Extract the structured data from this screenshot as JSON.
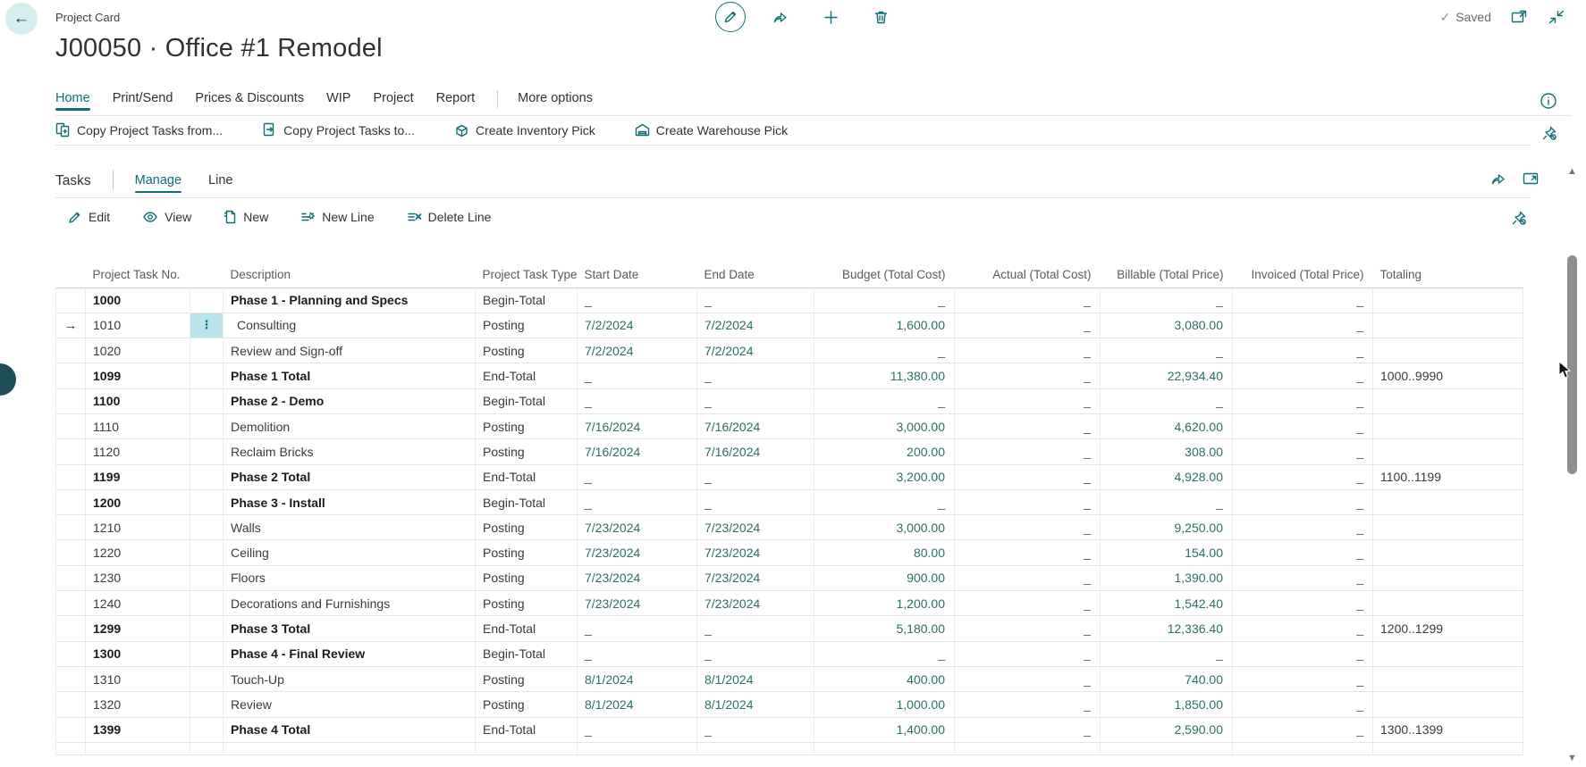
{
  "colors": {
    "accent": "#0e6f74",
    "value_teal": "#2a6f68",
    "selected_cell": "#b9e4ec"
  },
  "header": {
    "app_caption": "Project Card",
    "title": "J00050 · Office #1 Remodel",
    "saved_label": "Saved",
    "saved_check": "✓",
    "back_glyph": "←"
  },
  "tabs": {
    "items": [
      {
        "label": "Home",
        "active": true
      },
      {
        "label": "Print/Send",
        "active": false
      },
      {
        "label": "Prices & Discounts",
        "active": false
      },
      {
        "label": "WIP",
        "active": false
      },
      {
        "label": "Project",
        "active": false
      },
      {
        "label": "Report",
        "active": false
      }
    ],
    "more_label": "More options"
  },
  "actions": [
    {
      "label": "Copy Project Tasks from...",
      "icon": "copy-from-icon"
    },
    {
      "label": "Copy Project Tasks to...",
      "icon": "copy-to-icon"
    },
    {
      "label": "Create Inventory Pick",
      "icon": "inventory-pick-icon"
    },
    {
      "label": "Create Warehouse Pick",
      "icon": "warehouse-pick-icon"
    }
  ],
  "section": {
    "title": "Tasks",
    "menus": [
      {
        "label": "Manage",
        "active": true
      },
      {
        "label": "Line",
        "active": false
      }
    ]
  },
  "grid_actions": [
    {
      "label": "Edit",
      "icon": "edit-icon"
    },
    {
      "label": "View",
      "icon": "view-icon"
    },
    {
      "label": "New",
      "icon": "new-icon"
    },
    {
      "label": "New Line",
      "icon": "new-line-icon"
    },
    {
      "label": "Delete Line",
      "icon": "delete-line-icon"
    }
  ],
  "table": {
    "columns": [
      "Project Task No.",
      "Description",
      "Project Task Type",
      "Start Date",
      "End Date",
      "Budget (Total Cost)",
      "Actual (Total Cost)",
      "Billable (Total Price)",
      "Invoiced (Total Price)",
      "Totaling"
    ],
    "selection_glyphs": {
      "row_indicator": "→",
      "options_dots": "⋮"
    },
    "rows": [
      {
        "no": "1000",
        "desc": "Phase 1 - Planning and Specs",
        "type": "Begin-Total",
        "start": "_",
        "end": "_",
        "budget": "_",
        "actual": "_",
        "billable": "_",
        "invoiced": "_",
        "totaling": "",
        "bold": true,
        "selected": false,
        "indent": false
      },
      {
        "no": "1010",
        "desc": "Consulting",
        "type": "Posting",
        "start": "7/2/2024",
        "end": "7/2/2024",
        "budget": "1,600.00",
        "actual": "_",
        "billable": "3,080.00",
        "invoiced": "_",
        "totaling": "",
        "bold": false,
        "selected": true,
        "indent": true
      },
      {
        "no": "1020",
        "desc": "Review and Sign-off",
        "type": "Posting",
        "start": "7/2/2024",
        "end": "7/2/2024",
        "budget": "_",
        "actual": "_",
        "billable": "_",
        "invoiced": "_",
        "totaling": "",
        "bold": false,
        "selected": false,
        "indent": false
      },
      {
        "no": "1099",
        "desc": "Phase 1 Total",
        "type": "End-Total",
        "start": "_",
        "end": "_",
        "budget": "11,380.00",
        "actual": "_",
        "billable": "22,934.40",
        "invoiced": "_",
        "totaling": "1000..9990",
        "bold": true,
        "selected": false,
        "indent": false
      },
      {
        "no": "1100",
        "desc": "Phase 2 - Demo",
        "type": "Begin-Total",
        "start": "_",
        "end": "_",
        "budget": "_",
        "actual": "_",
        "billable": "_",
        "invoiced": "_",
        "totaling": "",
        "bold": true,
        "selected": false,
        "indent": false
      },
      {
        "no": "1110",
        "desc": "Demolition",
        "type": "Posting",
        "start": "7/16/2024",
        "end": "7/16/2024",
        "budget": "3,000.00",
        "actual": "_",
        "billable": "4,620.00",
        "invoiced": "_",
        "totaling": "",
        "bold": false,
        "selected": false,
        "indent": false
      },
      {
        "no": "1120",
        "desc": "Reclaim Bricks",
        "type": "Posting",
        "start": "7/16/2024",
        "end": "7/16/2024",
        "budget": "200.00",
        "actual": "_",
        "billable": "308.00",
        "invoiced": "_",
        "totaling": "",
        "bold": false,
        "selected": false,
        "indent": false
      },
      {
        "no": "1199",
        "desc": "Phase 2 Total",
        "type": "End-Total",
        "start": "_",
        "end": "_",
        "budget": "3,200.00",
        "actual": "_",
        "billable": "4,928.00",
        "invoiced": "_",
        "totaling": "1100..1199",
        "bold": true,
        "selected": false,
        "indent": false
      },
      {
        "no": "1200",
        "desc": "Phase 3 - Install",
        "type": "Begin-Total",
        "start": "_",
        "end": "_",
        "budget": "_",
        "actual": "_",
        "billable": "_",
        "invoiced": "_",
        "totaling": "",
        "bold": true,
        "selected": false,
        "indent": false
      },
      {
        "no": "1210",
        "desc": "Walls",
        "type": "Posting",
        "start": "7/23/2024",
        "end": "7/23/2024",
        "budget": "3,000.00",
        "actual": "_",
        "billable": "9,250.00",
        "invoiced": "_",
        "totaling": "",
        "bold": false,
        "selected": false,
        "indent": false
      },
      {
        "no": "1220",
        "desc": "Ceiling",
        "type": "Posting",
        "start": "7/23/2024",
        "end": "7/23/2024",
        "budget": "80.00",
        "actual": "_",
        "billable": "154.00",
        "invoiced": "_",
        "totaling": "",
        "bold": false,
        "selected": false,
        "indent": false
      },
      {
        "no": "1230",
        "desc": "Floors",
        "type": "Posting",
        "start": "7/23/2024",
        "end": "7/23/2024",
        "budget": "900.00",
        "actual": "_",
        "billable": "1,390.00",
        "invoiced": "_",
        "totaling": "",
        "bold": false,
        "selected": false,
        "indent": false
      },
      {
        "no": "1240",
        "desc": "Decorations and Furnishings",
        "type": "Posting",
        "start": "7/23/2024",
        "end": "7/23/2024",
        "budget": "1,200.00",
        "actual": "_",
        "billable": "1,542.40",
        "invoiced": "_",
        "totaling": "",
        "bold": false,
        "selected": false,
        "indent": false
      },
      {
        "no": "1299",
        "desc": "Phase 3 Total",
        "type": "End-Total",
        "start": "_",
        "end": "_",
        "budget": "5,180.00",
        "actual": "_",
        "billable": "12,336.40",
        "invoiced": "_",
        "totaling": "1200..1299",
        "bold": true,
        "selected": false,
        "indent": false
      },
      {
        "no": "1300",
        "desc": "Phase 4 - Final Review",
        "type": "Begin-Total",
        "start": "_",
        "end": "_",
        "budget": "_",
        "actual": "_",
        "billable": "_",
        "invoiced": "_",
        "totaling": "",
        "bold": true,
        "selected": false,
        "indent": false
      },
      {
        "no": "1310",
        "desc": "Touch-Up",
        "type": "Posting",
        "start": "8/1/2024",
        "end": "8/1/2024",
        "budget": "400.00",
        "actual": "_",
        "billable": "740.00",
        "invoiced": "_",
        "totaling": "",
        "bold": false,
        "selected": false,
        "indent": false
      },
      {
        "no": "1320",
        "desc": "Review",
        "type": "Posting",
        "start": "8/1/2024",
        "end": "8/1/2024",
        "budget": "1,000.00",
        "actual": "_",
        "billable": "1,850.00",
        "invoiced": "_",
        "totaling": "",
        "bold": false,
        "selected": false,
        "indent": false
      },
      {
        "no": "1399",
        "desc": "Phase 4 Total",
        "type": "End-Total",
        "start": "_",
        "end": "_",
        "budget": "1,400.00",
        "actual": "_",
        "billable": "2,590.00",
        "invoiced": "_",
        "totaling": "1300..1399",
        "bold": true,
        "selected": false,
        "indent": false
      }
    ]
  },
  "scrollbar": {
    "up_glyph": "▲",
    "down_glyph": "▼"
  }
}
